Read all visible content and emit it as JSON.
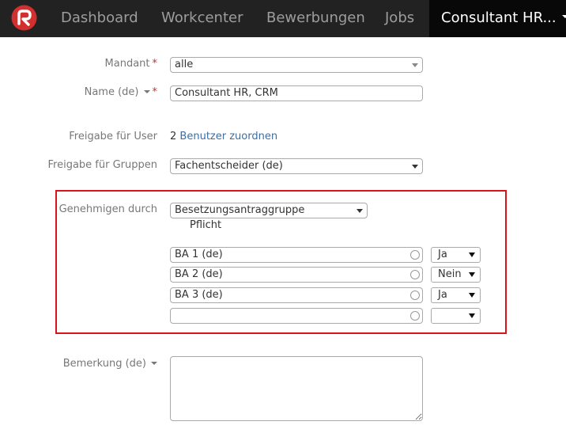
{
  "nav": {
    "items": [
      "Dashboard",
      "Workcenter",
      "Bewerbungen",
      "Jobs"
    ],
    "active": "Consultant HR..."
  },
  "form": {
    "mandant": {
      "label": "Mandant",
      "required": "*",
      "value": "alle"
    },
    "name": {
      "label": "Name (de)",
      "required": "*",
      "value": "Consultant HR, CRM"
    },
    "freigabe_user": {
      "label": "Freigabe für User",
      "count": "2",
      "link": "Benutzer zuordnen"
    },
    "freigabe_gruppen": {
      "label": "Freigabe für Gruppen",
      "value": "Fachentscheider (de)"
    },
    "genehmigen": {
      "label": "Genehmigen durch",
      "value": "Besetzungsantraggruppe",
      "sub_label": "Pflicht",
      "rows": [
        {
          "name": "BA 1 (de)",
          "pflicht": "Ja"
        },
        {
          "name": "BA 2 (de)",
          "pflicht": "Nein"
        },
        {
          "name": "BA 3 (de)",
          "pflicht": "Ja"
        },
        {
          "name": "",
          "pflicht": ""
        }
      ]
    },
    "bemerkung": {
      "label": "Bemerkung (de)",
      "value": ""
    }
  },
  "colors": {
    "navbar_bg": "#222222",
    "navbar_active_bg": "#080808",
    "highlight_border": "#d9151b",
    "required": "#c9302c",
    "link": "#3a6ea5",
    "logo": "#d32f2f"
  },
  "icons": {
    "logo": "red-circle-logo",
    "menu_caret": "caret-down-icon",
    "row_circle": "radio-circle-icon"
  }
}
